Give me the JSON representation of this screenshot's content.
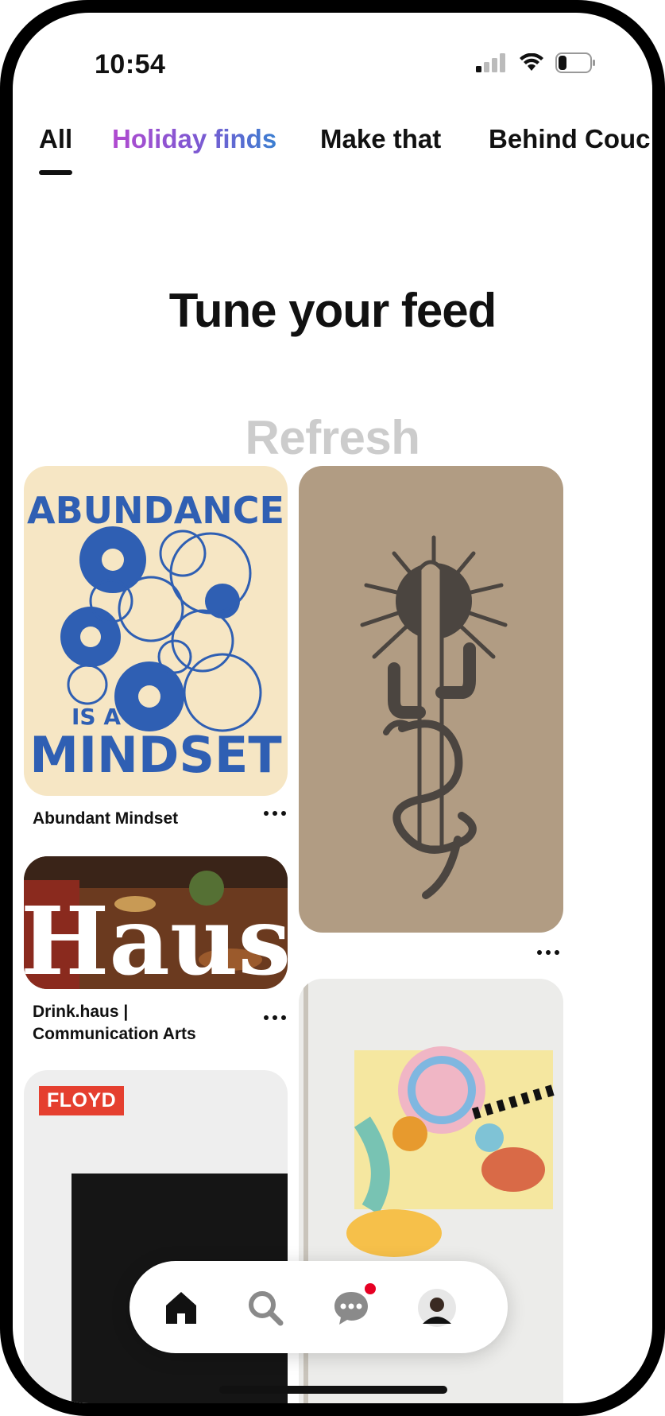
{
  "status_bar": {
    "time": "10:54"
  },
  "tabs": [
    {
      "label": "All",
      "selected": true
    },
    {
      "label": "Holiday finds",
      "selected": false
    },
    {
      "label": "Make that",
      "selected": false
    },
    {
      "label": "Behind Couc",
      "selected": false
    }
  ],
  "header": {
    "title": "Tune your feed",
    "refresh_label": "Refresh"
  },
  "pins": [
    {
      "title": "Abundant Mindset",
      "image_text": [
        "ABUNDANCE",
        "IS A",
        "MINDSET"
      ]
    },
    {
      "title": ""
    },
    {
      "title": "Drink.haus |\nCommunication Arts",
      "title_line1": "Drink.haus |",
      "title_line2": "Communication Arts",
      "image_text": "Haus"
    },
    {
      "title": ""
    },
    {
      "title": "",
      "tag": "FLOYD"
    }
  ],
  "bottom_nav": {
    "items": [
      {
        "icon": "home-icon",
        "active": true
      },
      {
        "icon": "search-icon",
        "active": false
      },
      {
        "icon": "messages-icon",
        "active": false,
        "notification": true
      },
      {
        "icon": "profile-avatar",
        "active": false
      }
    ]
  },
  "colors": {
    "accent_gradient": [
      "#b14ad0",
      "#3b7fd1"
    ],
    "notification": "#e60023",
    "refresh_text": "#cccccc",
    "floyd_tag": "#e53f2f"
  }
}
